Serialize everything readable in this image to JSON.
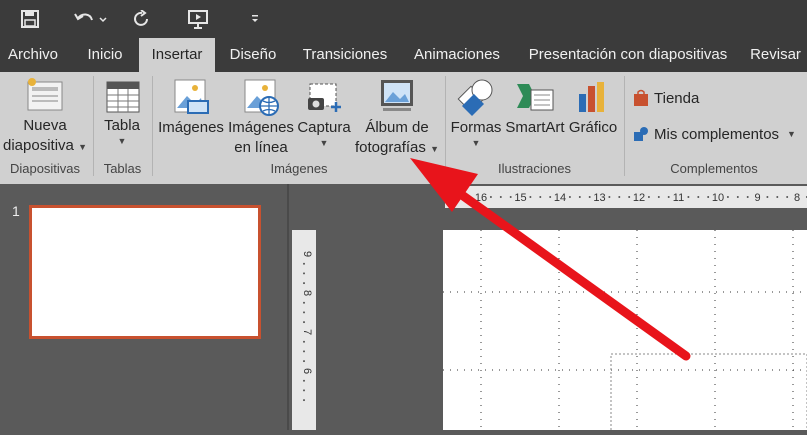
{
  "tabs": [
    "Archivo",
    "Inicio",
    "Insertar",
    "Diseño",
    "Transiciones",
    "Animaciones",
    "Presentación con diapositivas",
    "Revisar"
  ],
  "ribbon": {
    "nueva_line1": "Nueva",
    "nueva_line2": "diapositiva",
    "tabla": "Tabla",
    "imagenes": "Imágenes",
    "imagenes_linea1": "Imágenes",
    "imagenes_linea2": "en línea",
    "captura": "Captura",
    "album_line1": "Álbum de",
    "album_line2": "fotografías",
    "formas": "Formas",
    "smartart": "SmartArt",
    "grafico": "Gráfico",
    "tienda": "Tienda",
    "mis_complementos": "Mis complementos"
  },
  "groups": [
    "Diapositivas",
    "Tablas",
    "Imágenes",
    "Ilustraciones",
    "Complementos"
  ],
  "slides": {
    "number": "1"
  },
  "ruler_h": [
    "16",
    "15",
    "14",
    "13",
    "12",
    "11",
    "10",
    "9",
    "8"
  ],
  "ruler_v": [
    "9",
    "8",
    "7",
    "6"
  ],
  "colors": {
    "accent": "#c8512f",
    "arrow": "#e8141b"
  }
}
